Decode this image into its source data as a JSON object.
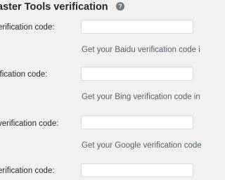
{
  "section": {
    "title": "aster Tools verification",
    "help_icon": "question-circle-icon",
    "help_glyph": "?"
  },
  "fields": [
    {
      "label": "erification code:",
      "value": "",
      "description": "Get your Baidu verification code i"
    },
    {
      "label": "ification code:",
      "value": "",
      "description": "Get your Bing verification code in"
    },
    {
      "label": "verification code:",
      "value": "",
      "description": "Get your Google verification code"
    },
    {
      "label": "erification code:",
      "value": "",
      "description": ""
    }
  ]
}
